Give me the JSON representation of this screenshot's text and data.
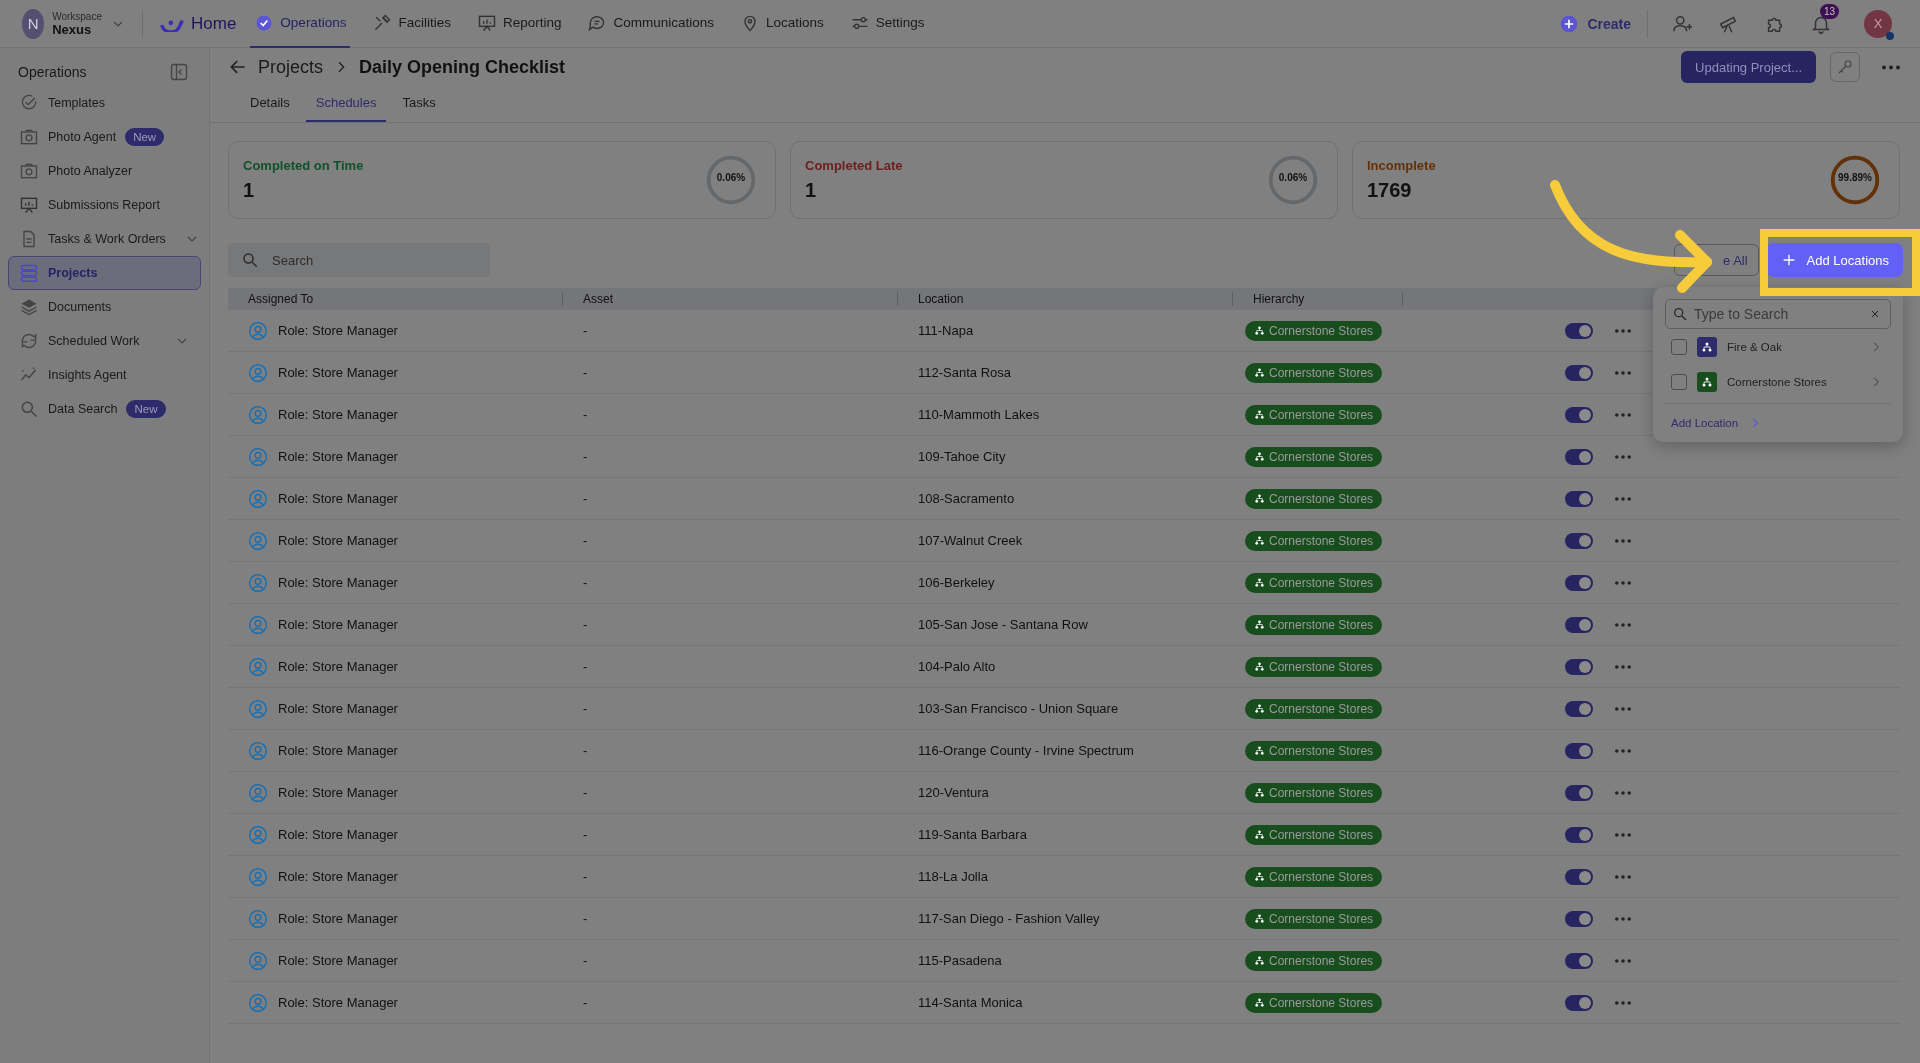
{
  "top_bar": {
    "workspace_avatar": "N",
    "workspace_label": "Workspace",
    "workspace_name": "Nexus",
    "home": "Home",
    "nav": [
      {
        "label": "Operations",
        "selected": true
      },
      {
        "label": "Facilities",
        "selected": false
      },
      {
        "label": "Reporting",
        "selected": false
      },
      {
        "label": "Communications",
        "selected": false
      },
      {
        "label": "Locations",
        "selected": false
      },
      {
        "label": "Settings",
        "selected": false
      }
    ],
    "create": "Create",
    "notifications_count": "13",
    "user_avatar": "X"
  },
  "sidebar": {
    "title": "Operations",
    "items": [
      {
        "label": "Templates",
        "expandable": false,
        "selected": false
      },
      {
        "label": "Photo Agent",
        "badge": "New",
        "expandable": false,
        "selected": false
      },
      {
        "label": "Photo Analyzer",
        "expandable": false,
        "selected": false
      },
      {
        "label": "Submissions Report",
        "expandable": false,
        "selected": false
      },
      {
        "label": "Tasks & Work Orders",
        "expandable": true,
        "selected": false
      },
      {
        "label": "Projects",
        "expandable": false,
        "selected": true
      },
      {
        "label": "Documents",
        "expandable": false,
        "selected": false
      },
      {
        "label": "Scheduled Work",
        "expandable": true,
        "selected": false
      },
      {
        "label": "Insights Agent",
        "expandable": false,
        "selected": false
      },
      {
        "label": "Data Search",
        "badge": "New",
        "expandable": false,
        "selected": false
      }
    ]
  },
  "header": {
    "breadcrumb": "Projects",
    "title": "Daily Opening Checklist",
    "status_button": "Updating Project..."
  },
  "tabs": [
    {
      "label": "Details",
      "selected": false
    },
    {
      "label": "Schedules",
      "selected": true
    },
    {
      "label": "Tasks",
      "selected": false
    }
  ],
  "summary_cards": [
    {
      "title": "Completed on Time",
      "color": "#10502b",
      "value": "1",
      "percent": "0.06%",
      "level": 0.0006
    },
    {
      "title": "Completed Late",
      "color": "#6d1e1e",
      "value": "1",
      "percent": "0.06%",
      "level": 0.0006
    },
    {
      "title": "Incomplete",
      "color": "#643005",
      "value": "1769",
      "percent": "99.89%",
      "level": 0.9989
    }
  ],
  "search": {
    "placeholder": "Search"
  },
  "remove_all_button": "e All",
  "add_locations_button": "Add Locations",
  "table": {
    "columns": [
      "Assigned To",
      "Asset",
      "Location",
      "Hierarchy"
    ],
    "rows": [
      {
        "assigned_to": "Role: Store Manager",
        "asset": "-",
        "location": "111-Napa",
        "hierarchy": "Cornerstone Stores",
        "enabled": true
      },
      {
        "assigned_to": "Role: Store Manager",
        "asset": "-",
        "location": "112-Santa Rosa",
        "hierarchy": "Cornerstone Stores",
        "enabled": true
      },
      {
        "assigned_to": "Role: Store Manager",
        "asset": "-",
        "location": "110-Mammoth Lakes",
        "hierarchy": "Cornerstone Stores",
        "enabled": true
      },
      {
        "assigned_to": "Role: Store Manager",
        "asset": "-",
        "location": "109-Tahoe City",
        "hierarchy": "Cornerstone Stores",
        "enabled": true
      },
      {
        "assigned_to": "Role: Store Manager",
        "asset": "-",
        "location": "108-Sacramento",
        "hierarchy": "Cornerstone Stores",
        "enabled": true
      },
      {
        "assigned_to": "Role: Store Manager",
        "asset": "-",
        "location": "107-Walnut Creek",
        "hierarchy": "Cornerstone Stores",
        "enabled": true
      },
      {
        "assigned_to": "Role: Store Manager",
        "asset": "-",
        "location": "106-Berkeley",
        "hierarchy": "Cornerstone Stores",
        "enabled": true
      },
      {
        "assigned_to": "Role: Store Manager",
        "asset": "-",
        "location": "105-San Jose - Santana Row",
        "hierarchy": "Cornerstone Stores",
        "enabled": true
      },
      {
        "assigned_to": "Role: Store Manager",
        "asset": "-",
        "location": "104-Palo Alto",
        "hierarchy": "Cornerstone Stores",
        "enabled": true
      },
      {
        "assigned_to": "Role: Store Manager",
        "asset": "-",
        "location": "103-San Francisco - Union Square",
        "hierarchy": "Cornerstone Stores",
        "enabled": true
      },
      {
        "assigned_to": "Role: Store Manager",
        "asset": "-",
        "location": "116-Orange County - Irvine Spectrum",
        "hierarchy": "Cornerstone Stores",
        "enabled": true
      },
      {
        "assigned_to": "Role: Store Manager",
        "asset": "-",
        "location": "120-Ventura",
        "hierarchy": "Cornerstone Stores",
        "enabled": true
      },
      {
        "assigned_to": "Role: Store Manager",
        "asset": "-",
        "location": "119-Santa Barbara",
        "hierarchy": "Cornerstone Stores",
        "enabled": true
      },
      {
        "assigned_to": "Role: Store Manager",
        "asset": "-",
        "location": "118-La Jolla",
        "hierarchy": "Cornerstone Stores",
        "enabled": true
      },
      {
        "assigned_to": "Role: Store Manager",
        "asset": "-",
        "location": "117-San Diego - Fashion Valley",
        "hierarchy": "Cornerstone Stores",
        "enabled": true
      },
      {
        "assigned_to": "Role: Store Manager",
        "asset": "-",
        "location": "115-Pasadena",
        "hierarchy": "Cornerstone Stores",
        "enabled": true
      },
      {
        "assigned_to": "Role: Store Manager",
        "asset": "-",
        "location": "114-Santa Monica",
        "hierarchy": "Cornerstone Stores",
        "enabled": true
      }
    ]
  },
  "location_menu": {
    "search_placeholder": "Type to Search",
    "items": [
      {
        "label": "Fire & Oak",
        "checked": false,
        "color": "#2e2b6b"
      },
      {
        "label": "Cornerstone Stores",
        "checked": false,
        "color": "#184d1e"
      }
    ],
    "add_link": "Add Location"
  }
}
